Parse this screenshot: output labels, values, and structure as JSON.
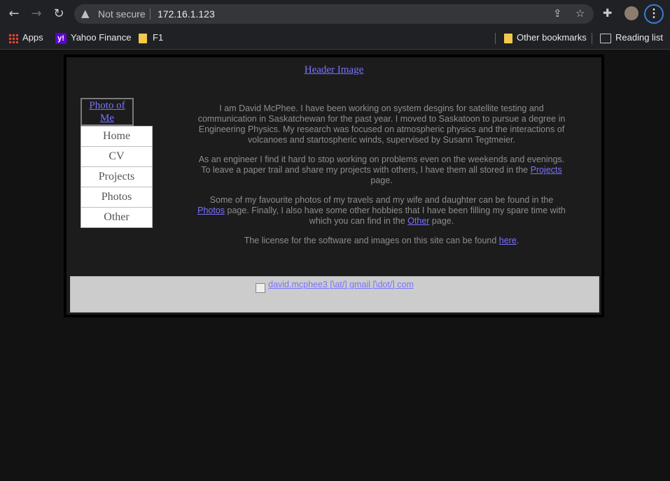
{
  "browser": {
    "security_label": "Not secure",
    "url": "172.16.1.123",
    "bookmarks": [
      {
        "label": "Apps"
      },
      {
        "label": "Yahoo Finance"
      },
      {
        "label": "F1"
      }
    ],
    "other_bookmarks": "Other bookmarks",
    "reading_list": "Reading list"
  },
  "page": {
    "header_alt": "Header Image",
    "photo_alt": "Photo of Me",
    "nav": [
      "Home",
      "CV",
      "Projects",
      "Photos",
      "Other"
    ],
    "p1": "I am David McPhee. I have been working on system desgins for satellite testing and communication in Saskatchewan for the past year. I moved to Saskatoon to pursue a degree in Engineering Physics. My research was focused on atmospheric physics and the interactions of volcanoes and startospheric winds, supervised by Susann Tegtmeier.",
    "p2_before": "As an engineer I find it hard to stop working on problems even on the weekends and evenings. To leave a paper trail and share my projects with others, I have them all stored in the ",
    "p2_link": "Projects",
    "p2_after": " page.",
    "p3_before": "Some of my favourite photos of my travels and my wife and daughter can be found in the ",
    "p3_link1": "Photos",
    "p3_middle": " page. Finally, I also have some other hobbies that I have been filling my spare time with which you can find in the ",
    "p3_link2": "Other",
    "p3_after": " page.",
    "p4_before": "The license for the software and images on this site can be found ",
    "p4_link": "here",
    "p4_after": ".",
    "footer_email": "david.mcphee3 [\\at/] gmail [\\dot/] com"
  },
  "colors": {
    "link": "#7a73ff",
    "page_bg": "#121212",
    "frame_bg": "#1c1c1c",
    "footer_bg": "#cccccc"
  }
}
